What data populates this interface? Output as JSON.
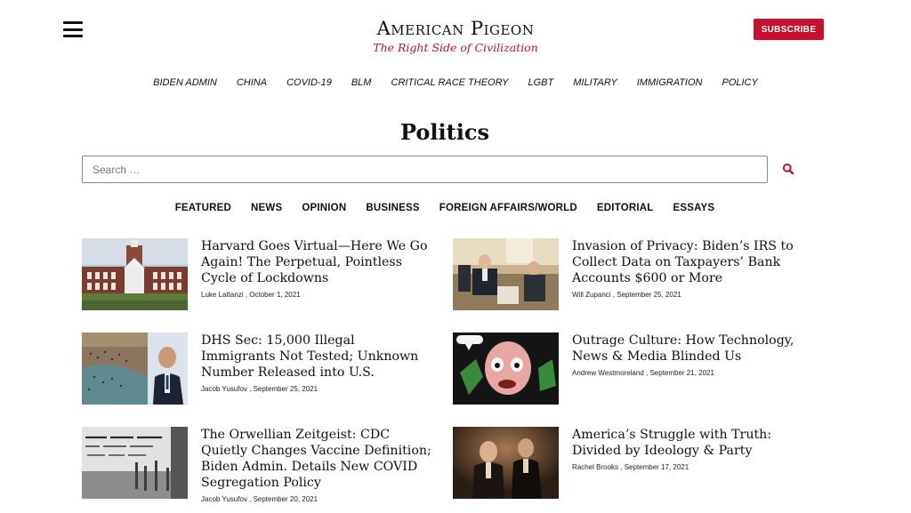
{
  "header": {
    "brand_title": "American Pigeon",
    "tagline": "The Right Side of Civilization",
    "subscribe_label": "SUBSCRIBE"
  },
  "topnav": [
    "BIDEN ADMIN",
    "CHINA",
    "COVID-19",
    "BLM",
    "CRITICAL RACE THEORY",
    "LGBT",
    "MILITARY",
    "IMMIGRATION",
    "POLICY"
  ],
  "page": {
    "title": "Politics",
    "search_placeholder": "Search …"
  },
  "subnav": [
    "FEATURED",
    "NEWS",
    "OPINION",
    "BUSINESS",
    "FOREIGN AFFAIRS/WORLD",
    "EDITORIAL",
    "ESSAYS"
  ],
  "articles": [
    {
      "title": "Harvard Goes Virtual—Here We Go Again! The Perpetual, Pointless Cycle of Lockdowns",
      "author": "Luke Lattanzi",
      "date": "October 1, 2021",
      "image": "harvard-building-photo"
    },
    {
      "title": "Invasion of Privacy: Biden’s IRS to Collect Data on Taxpayers’ Bank Accounts $600 or More",
      "author": "Will Zupanci",
      "date": "September 25, 2021",
      "image": "oval-office-meeting-photo"
    },
    {
      "title": "DHS Sec: 15,000 Illegal Immigrants Not Tested; Unknown Number Released into U.S.",
      "author": "Jacob Yusufov",
      "date": "September 25, 2021",
      "image": "border-crowd-photo"
    },
    {
      "title": "Outrage Culture: How Technology, News & Media Blinded Us",
      "author": "Andrew Westmoreland",
      "date": "September 21, 2021",
      "image": "comic-illustration"
    },
    {
      "title": "The Orwellian Zeitgeist: CDC Quietly Changes Vaccine Definition; Biden Admin. Details New COVID Segregation Policy",
      "author": "Jacob Yusufov",
      "date": "September 20, 2021",
      "image": "animal-farm-wall-photo"
    },
    {
      "title": "America’s Struggle with Truth: Divided by Ideology & Party",
      "author": "Rachel Brooks",
      "date": "September 17, 2021",
      "image": "two-men-vintage-photo"
    }
  ]
}
